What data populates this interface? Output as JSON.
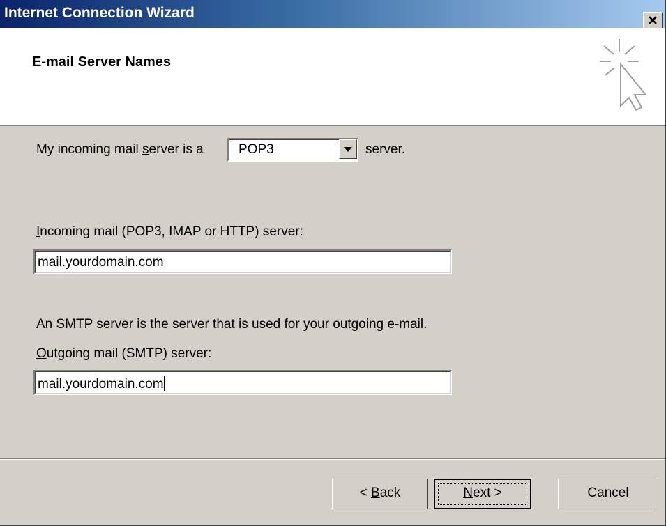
{
  "window": {
    "title": "Internet Connection Wizard",
    "close_glyph": "×"
  },
  "header": {
    "title": "E-mail Server Names",
    "icon": "wizard-cursor-icon"
  },
  "form": {
    "incoming_type": {
      "label_prefix": "My incoming mail ",
      "label_accel": "s",
      "label_suffix": "erver is a",
      "selected": "POP3",
      "after_label": "server."
    },
    "incoming_server": {
      "label_accel": "I",
      "label_rest": "ncoming mail (POP3, IMAP or HTTP) server:",
      "value": "mail.yourdomain.com"
    },
    "smtp_note": "An SMTP server is the server that is used for your outgoing e-mail.",
    "outgoing_server": {
      "label_accel": "O",
      "label_rest": "utgoing mail (SMTP) server:",
      "value": "mail.yourdomain.com"
    }
  },
  "buttons": {
    "back_prefix": "< ",
    "back_accel": "B",
    "back_rest": "ack",
    "next_accel": "N",
    "next_rest": "ext >",
    "cancel": "Cancel"
  },
  "colors": {
    "titlebar_start": "#0a246a",
    "titlebar_end": "#a6caf0",
    "dialog_bg": "#d4d0c8"
  }
}
